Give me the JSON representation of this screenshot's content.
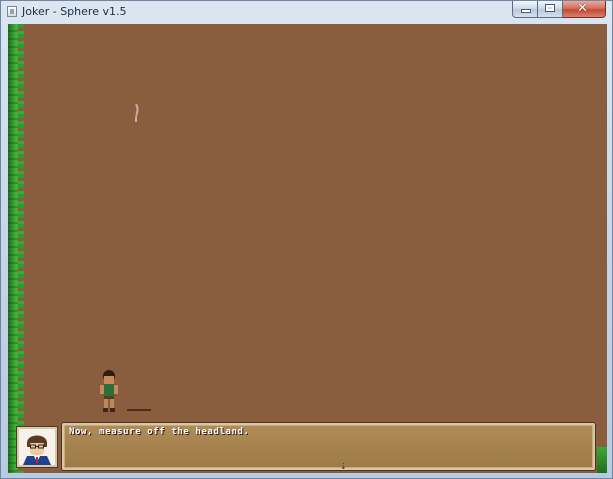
{
  "window": {
    "title": "Joker - Sphere v1.5",
    "close_glyph": "✕"
  },
  "icons": {
    "app": "app-window-icon",
    "minimize": "minimize-icon",
    "maximize": "maximize-icon",
    "close": "close-icon",
    "continue": "continue-arrow-icon"
  },
  "scene": {
    "ground_color": "#8a5d3e",
    "grass_color": "#2f9a2d"
  },
  "dialogue": {
    "text": "Now, measure off the headland.",
    "continue_glyph": "⇣"
  }
}
